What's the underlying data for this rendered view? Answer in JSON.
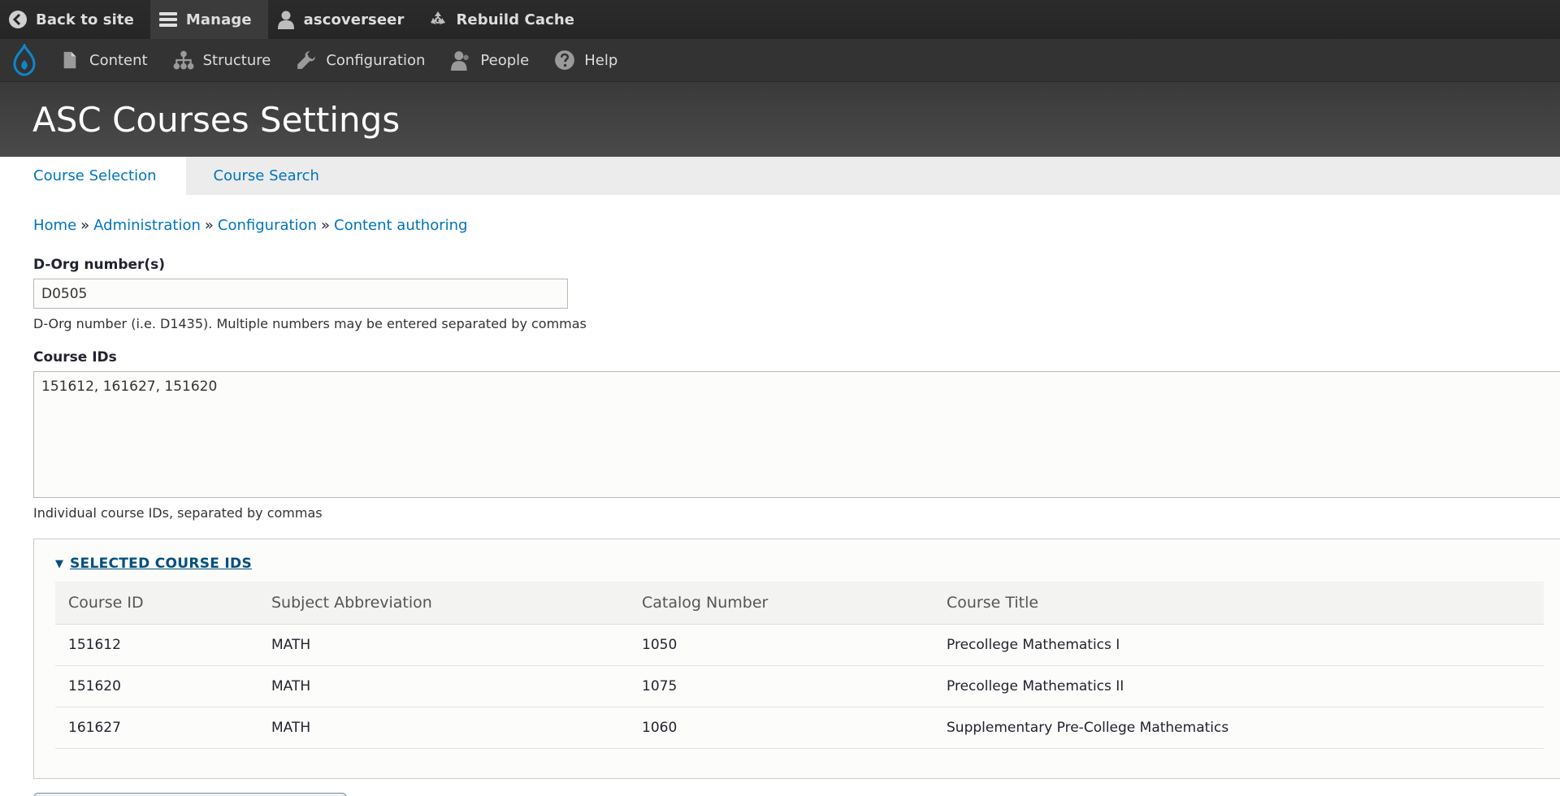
{
  "toolbar": {
    "items": [
      {
        "label": "Back to site",
        "icon": "back-circle-icon"
      },
      {
        "label": "Manage",
        "icon": "hamburger-icon"
      },
      {
        "label": "ascoverseer",
        "icon": "user-icon"
      },
      {
        "label": "Rebuild Cache",
        "icon": "recycle-icon"
      }
    ]
  },
  "tray": {
    "logo": "drupal-logo",
    "items": [
      {
        "label": "Content",
        "icon": "file-icon"
      },
      {
        "label": "Structure",
        "icon": "sitemap-icon"
      },
      {
        "label": "Configuration",
        "icon": "wrench-icon"
      },
      {
        "label": "People",
        "icon": "people-icon"
      },
      {
        "label": "Help",
        "icon": "help-icon"
      }
    ]
  },
  "page": {
    "title": "ASC Courses Settings"
  },
  "tabs": [
    {
      "label": "Course Selection",
      "active": true
    },
    {
      "label": "Course Search",
      "active": false
    }
  ],
  "breadcrumb": {
    "items": [
      "Home",
      "Administration",
      "Configuration",
      "Content authoring"
    ],
    "separator": "»"
  },
  "form": {
    "dorg": {
      "label": "D-Org number(s)",
      "value": "D0505",
      "description": "D-Org number (i.e. D1435). Multiple numbers may be entered separated by commas"
    },
    "course_ids": {
      "label": "Course IDs",
      "value": "151612, 161627, 151620",
      "description": "Individual course IDs, separated by commas"
    }
  },
  "selected": {
    "summary": "SELECTED COURSE IDS",
    "caret": "▼",
    "columns": [
      "Course ID",
      "Subject Abbreviation",
      "Catalog Number",
      "Course Title"
    ],
    "rows": [
      [
        "151612",
        "MATH",
        "1050",
        "Precollege Mathematics I"
      ],
      [
        "151620",
        "MATH",
        "1075",
        "Precollege Mathematics II"
      ],
      [
        "161627",
        "MATH",
        "1060",
        "Supplementary Pre-College Mathematics"
      ]
    ]
  },
  "colors": {
    "link": "#0074bd",
    "toolbar_bg": "#262626",
    "tray_bg": "#333333",
    "header_bg": "#494949",
    "drupal_blue": "#0e87c9"
  }
}
